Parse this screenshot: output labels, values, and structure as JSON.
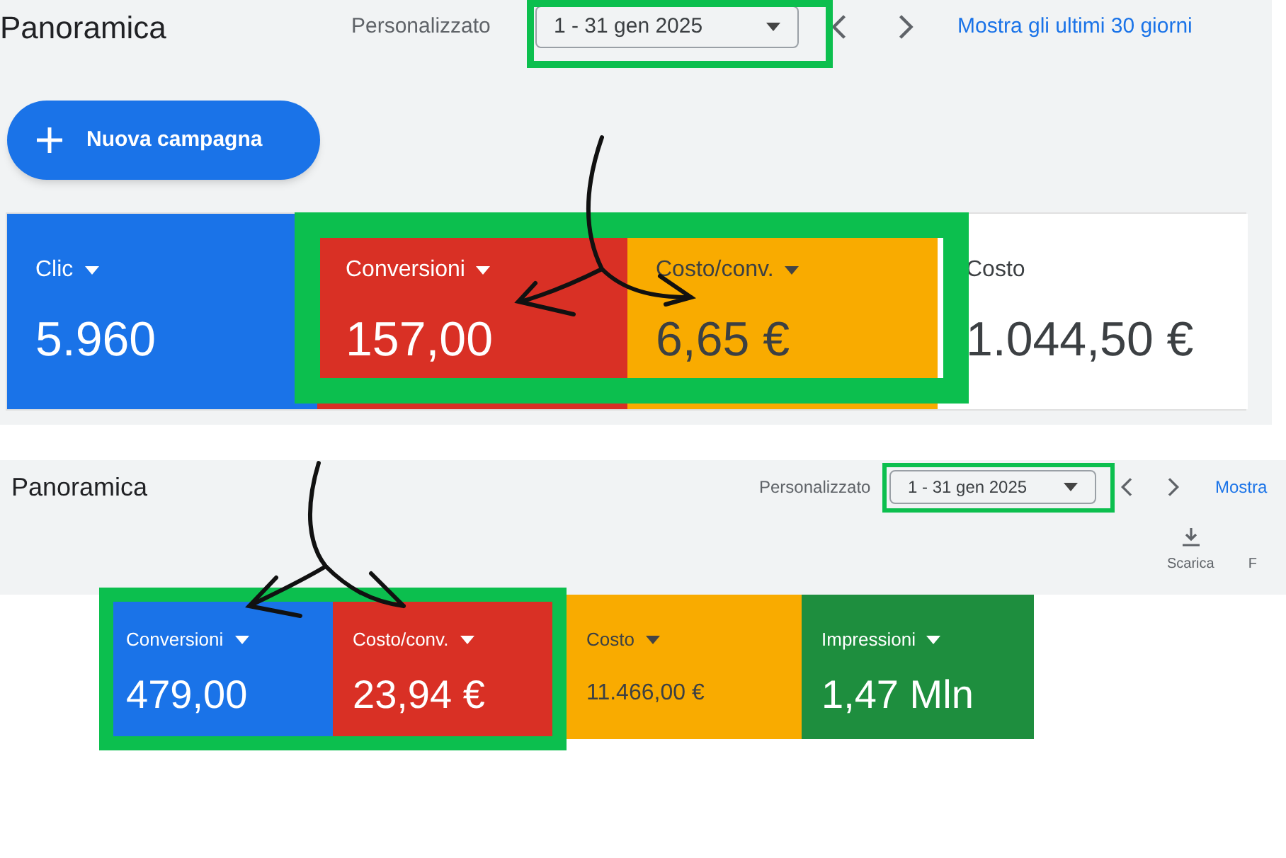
{
  "panels": [
    {
      "title": "Panoramica",
      "range_label": "Personalizzato",
      "date_range": "1 - 31 gen 2025",
      "link": "Mostra gli ultimi 30 giorni",
      "new_campaign": "Nuova campagna",
      "metrics": [
        {
          "label": "Clic",
          "value": "5.960",
          "color": "#1a73e8",
          "dropdown": true,
          "kind": "large"
        },
        {
          "label": "Conversioni",
          "value": "157,00",
          "color": "#d93025",
          "dropdown": true,
          "kind": "large"
        },
        {
          "label": "Costo/conv.",
          "value": "6,65 €",
          "color": "#f9ab00",
          "dropdown": true,
          "kind": "large"
        },
        {
          "label": "Costo",
          "value": "1.044,50 €",
          "color": "#ffffff",
          "dropdown": false,
          "kind": "large"
        }
      ]
    },
    {
      "title": "Panoramica",
      "range_label": "Personalizzato",
      "date_range": "1 - 31 gen 2025",
      "link": "Mostra",
      "toolbar": [
        "Scarica",
        "F"
      ],
      "metrics": [
        {
          "label": "Conversioni",
          "value": "479,00",
          "color": "#1a73e8",
          "dropdown": true,
          "kind": "large"
        },
        {
          "label": "Costo/conv.",
          "value": "23,94 €",
          "color": "#d93025",
          "dropdown": true,
          "kind": "large"
        },
        {
          "label": "Costo",
          "value": "11.466,00 €",
          "color": "#f9ab00",
          "dropdown": true,
          "kind": "small"
        },
        {
          "label": "Impressioni",
          "value": "1,47 Mln",
          "color": "#1e8e3e",
          "dropdown": true,
          "kind": "large"
        }
      ]
    }
  ]
}
